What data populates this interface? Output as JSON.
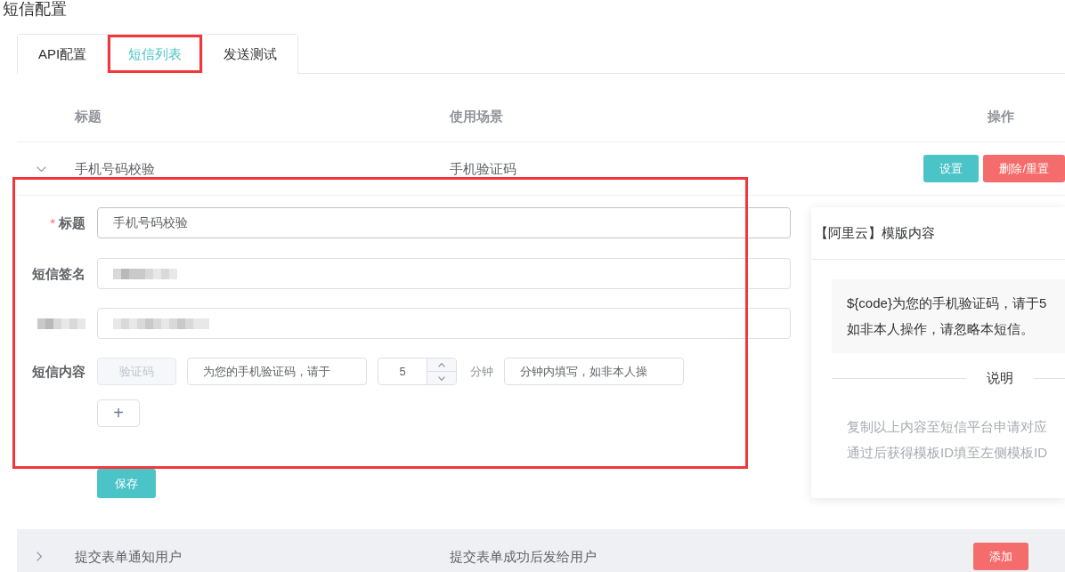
{
  "page": {
    "title": "短信配置"
  },
  "tabs": [
    {
      "label": "API配置",
      "selected": false,
      "highlighted": false
    },
    {
      "label": "短信列表",
      "selected": true,
      "highlighted": true
    },
    {
      "label": "发送测试",
      "selected": false,
      "highlighted": false
    }
  ],
  "table": {
    "columns": [
      "标题",
      "使用场景",
      "操作"
    ],
    "rows": [
      {
        "title": "手机号码校验",
        "scene": "手机验证码",
        "expanded": true,
        "hovered": false,
        "actions": [
          {
            "kind": "primary",
            "label": "设置"
          },
          {
            "kind": "danger",
            "label": "删除/重置"
          }
        ],
        "detail": {
          "highlighted": true,
          "required_mark": "*",
          "fields": [
            {
              "kind": "text",
              "label": "标题",
              "required": true,
              "value": "手机号码校验"
            },
            {
              "kind": "text",
              "label": "短信签名",
              "required": false,
              "value_redacted": true
            },
            {
              "kind": "text",
              "label_redacted": true,
              "value_redacted": true
            },
            {
              "kind": "content",
              "label": "短信内容",
              "required": false,
              "parts": [
                {
                  "kind": "tag",
                  "text": "验证码"
                },
                {
                  "kind": "input",
                  "value": "为您的手机验证码，请于"
                },
                {
                  "kind": "number",
                  "value": "5"
                },
                {
                  "kind": "unit",
                  "text": "分钟"
                },
                {
                  "kind": "input",
                  "value": "分钟内填写，如非本人操"
                }
              ]
            }
          ],
          "add_button": "+",
          "save_button": "保存",
          "template_card": {
            "title": "【阿里云】模版内容",
            "content_lines": [
              "${code}为您的手机验证码，请于5",
              "如非本人操作，请忽略本短信。"
            ],
            "divider_label": "说明",
            "note_lines": [
              "复制以上内容至短信平台申请对应",
              "通过后获得模板ID填至左侧模板ID"
            ]
          }
        }
      },
      {
        "title": "提交表单通知用户",
        "scene": "提交表单成功后发给用户",
        "expanded": false,
        "hovered": true,
        "actions": [
          {
            "kind": "danger",
            "label": "添加"
          }
        ]
      }
    ]
  }
}
